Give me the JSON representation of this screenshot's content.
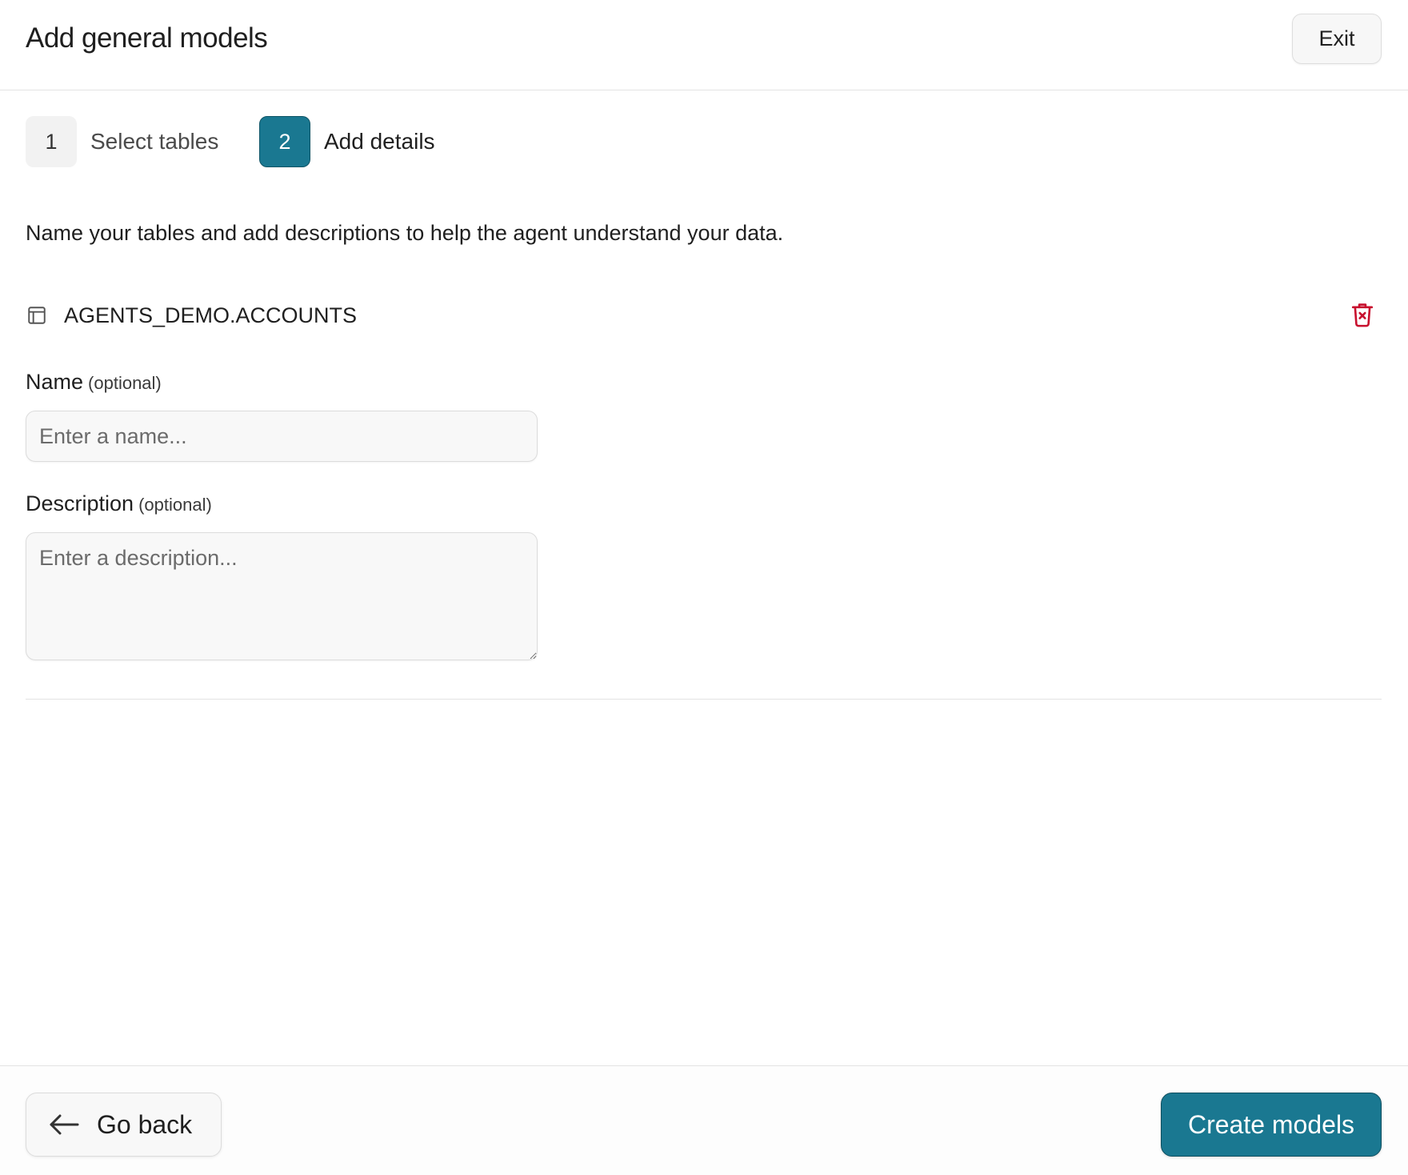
{
  "header": {
    "title": "Add general models",
    "exit_label": "Exit"
  },
  "stepper": {
    "steps": [
      {
        "number": "1",
        "label": "Select tables",
        "state": "complete"
      },
      {
        "number": "2",
        "label": "Add details",
        "state": "active"
      }
    ]
  },
  "intro_text": "Name your tables and add descriptions to help the agent understand your data.",
  "table": {
    "icon": "table-icon",
    "name": "AGENTS_DEMO.ACCOUNTS",
    "delete_icon": "trash-icon"
  },
  "form": {
    "name": {
      "label": "Name",
      "optional": "(optional)",
      "value": "",
      "placeholder": "Enter a name..."
    },
    "description": {
      "label": "Description",
      "optional": "(optional)",
      "value": "",
      "placeholder": "Enter a description..."
    }
  },
  "footer": {
    "back_label": "Go back",
    "back_icon": "arrow-left-icon",
    "create_label": "Create models"
  },
  "colors": {
    "accent": "#1a7891",
    "danger": "#c8102e",
    "border": "#dcdcdc"
  }
}
